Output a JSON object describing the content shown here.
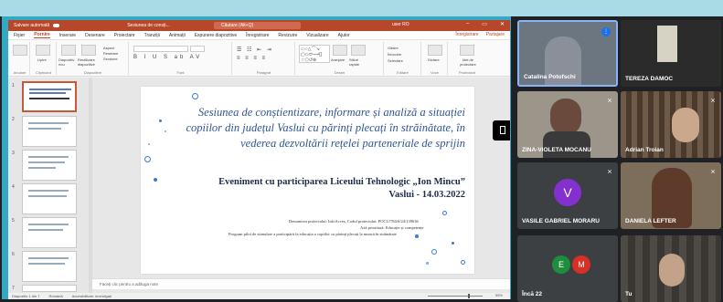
{
  "powerpoint": {
    "titlebar": {
      "autosave": "Salvare automată",
      "file_name": "Sesiunea de consți...",
      "search": "Căutare (Alt+Q)",
      "user": "user RO"
    },
    "menu": [
      "Fișier",
      "Pornire",
      "Inserare",
      "Desenare",
      "Proiectare",
      "Tranziții",
      "Animații",
      "Expunere diapozitive",
      "Înregistrare",
      "Revizuire",
      "Vizualizare",
      "Ajutor"
    ],
    "menu_active": "Pornire",
    "record_btn": "Înregistrare",
    "share_btn": "Partajare",
    "ribbon": {
      "undo": "Anulare",
      "paste": "Lipire",
      "new_slide": "Diapozitiv nou",
      "reuse_slides": "Reutilizare diapozitive",
      "layout": "Aspect",
      "reset": "Resetare",
      "section": "Secțiune",
      "arrange": "Aranjare",
      "quick_styles": "Stiluri rapide",
      "find": "Găsire",
      "replace": "Înlocuire",
      "select": "Selectare",
      "dictate": "Dictare",
      "designer": "Idei de proiectare",
      "groups": [
        "Clipboard",
        "Diapozitive",
        "Font",
        "Paragraf",
        "Desen",
        "Editare",
        "Voce",
        "Proiectant"
      ]
    },
    "thumbnails": [
      "1",
      "2",
      "3",
      "4",
      "5",
      "6",
      "7"
    ],
    "slide": {
      "title": "Sesiunea de conștientizare, informare și analiză a situației copiilor din județul Vaslui cu părinți plecați în străinătate, în vederea dezvoltării rețelei parteneriale de sprijin",
      "event": "Eveniment cu participarea  Liceului Tehnologic „Ion Mincu”",
      "date": "Vaslui - 14.03.2022",
      "project_line1": "Denumirea proiectului: InfoAcces, Codul proiectului: POCU/784/6/24/139636",
      "project_line2": "Axă prioritară: Educație și competențe",
      "project_line3": "Program pilot de stimulare a participării la educația a copiilor cu părinți plecați la muncă în străinătate"
    },
    "notes_placeholder": "Faceți clic pentru a adăuga note",
    "status": {
      "slide_of": "Diapozitiv 1 din 7",
      "language": "Română",
      "accessibility": "Accesibilitate: investigați",
      "zoom": "55%"
    }
  },
  "participants": [
    {
      "name": "Catalina Potofschi",
      "speaking": true
    },
    {
      "name": "TEREZA DAMOC",
      "muted": false
    },
    {
      "name": "ZINA-VIOLETA MOCANU",
      "muted": true
    },
    {
      "name": "Adrian Troian",
      "muted": true
    },
    {
      "name": "VASILE GABRIEL MORARU",
      "initial": "V",
      "muted": true
    },
    {
      "name": "DANIELA LEFTER",
      "muted": true
    },
    {
      "name": "Încă 22",
      "initials": [
        "E",
        "M"
      ]
    },
    {
      "name": "Tu"
    }
  ],
  "colors": {
    "ppt_accent": "#b7472a",
    "meet_bg": "#202124",
    "slide_title": "#2f5597",
    "avatar_v": "#8430ce",
    "avatar_e": "#1e8e3e",
    "avatar_m": "#d93025"
  }
}
